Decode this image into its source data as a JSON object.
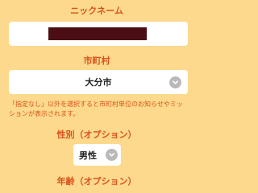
{
  "nickname": {
    "label": "ニックネーム",
    "value": ""
  },
  "city": {
    "label": "市町村",
    "selected": "大分市",
    "note": "「指定なし」以外を選択すると市町村単位のお知らせやミッションが表示されます。"
  },
  "gender": {
    "label": "性別（オプション）",
    "selected": "男性"
  },
  "age": {
    "label": "年齢（オプション）"
  },
  "colors": {
    "background": "#FCD98C",
    "label": "#D9531E",
    "field": "#FFFFFF",
    "chevron": "#B9B9B9"
  },
  "icons": {
    "dropdown": "chevron-down-icon"
  }
}
